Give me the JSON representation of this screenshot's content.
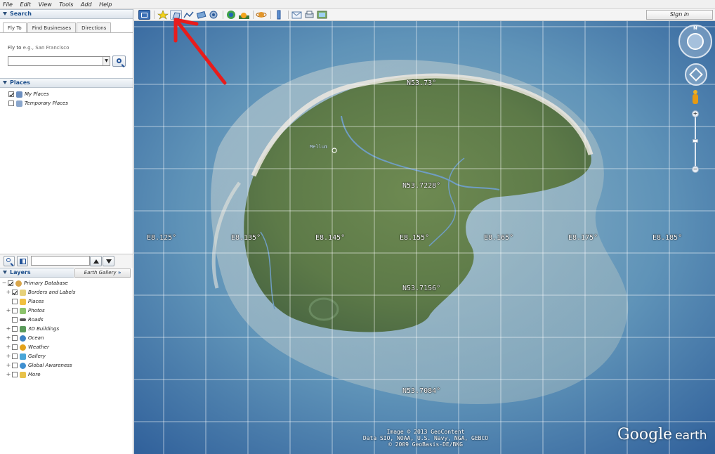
{
  "menu": [
    "File",
    "Edit",
    "View",
    "Tools",
    "Add",
    "Help"
  ],
  "search": {
    "header": "Search",
    "tabs": [
      "Fly To",
      "Find Businesses",
      "Directions"
    ],
    "fly_to_label": "Fly to",
    "fly_to_placeholder": "e.g., San Francisco",
    "fly_to_value": ""
  },
  "places": {
    "header": "Places",
    "items": [
      {
        "label": "My Places",
        "checked": true,
        "icon": "folder-globe-icon"
      },
      {
        "label": "Temporary Places",
        "checked": false,
        "icon": "folder-icon"
      }
    ]
  },
  "layers": {
    "header": "Layers",
    "gallery_button": "Earth Gallery",
    "gallery_chevron": "»",
    "items": [
      {
        "label": "Primary Database",
        "checked": true,
        "icon": "database-icon",
        "level": 0
      },
      {
        "label": "Borders and Labels",
        "checked": true,
        "icon": "borders-icon",
        "level": 1
      },
      {
        "label": "Places",
        "checked": false,
        "icon": "places-icon",
        "level": 1
      },
      {
        "label": "Photos",
        "checked": false,
        "icon": "photos-icon",
        "level": 1
      },
      {
        "label": "Roads",
        "checked": false,
        "icon": "roads-icon",
        "level": 1
      },
      {
        "label": "3D Buildings",
        "checked": false,
        "icon": "buildings-icon",
        "level": 1
      },
      {
        "label": "Ocean",
        "checked": false,
        "icon": "ocean-icon",
        "level": 1
      },
      {
        "label": "Weather",
        "checked": false,
        "icon": "weather-icon",
        "level": 1
      },
      {
        "label": "Gallery",
        "checked": false,
        "icon": "gallery-icon",
        "level": 1
      },
      {
        "label": "Global Awareness",
        "checked": false,
        "icon": "global-awareness-icon",
        "level": 1
      },
      {
        "label": "More",
        "checked": false,
        "icon": "more-icon",
        "level": 1
      }
    ]
  },
  "toolbar": {
    "sign_in": "Sign in",
    "buttons": [
      "sidebar-toggle",
      "placemark",
      "polygon",
      "path",
      "image-overlay",
      "record-tour",
      "historical-imagery",
      "sun",
      "planets",
      "ruler",
      "email",
      "print",
      "save-image"
    ]
  },
  "map": {
    "place_label": "Mellum",
    "lon_labels": [
      "E8.125°",
      "E8.135°",
      "E8.145°",
      "E8.155°",
      "E8.165°",
      "E8.175°",
      "E8.185°"
    ],
    "lat_labels": [
      "N53.73°",
      "N53.7228°",
      "N53.7156°",
      "N53.7084°"
    ],
    "credits": [
      "Image © 2013 GeoContent",
      "Data SIO, NOAA, U.S. Navy, NGA, GEBCO",
      "© 2009 GeoBasis-DE/BKG"
    ],
    "logo_main": "Google",
    "logo_sub": "earth"
  },
  "colors": {
    "accent": "#1d4f8c",
    "annotation_arrow": "#e81c1c",
    "water": "#4f87b5",
    "land": "#5f7a45"
  }
}
